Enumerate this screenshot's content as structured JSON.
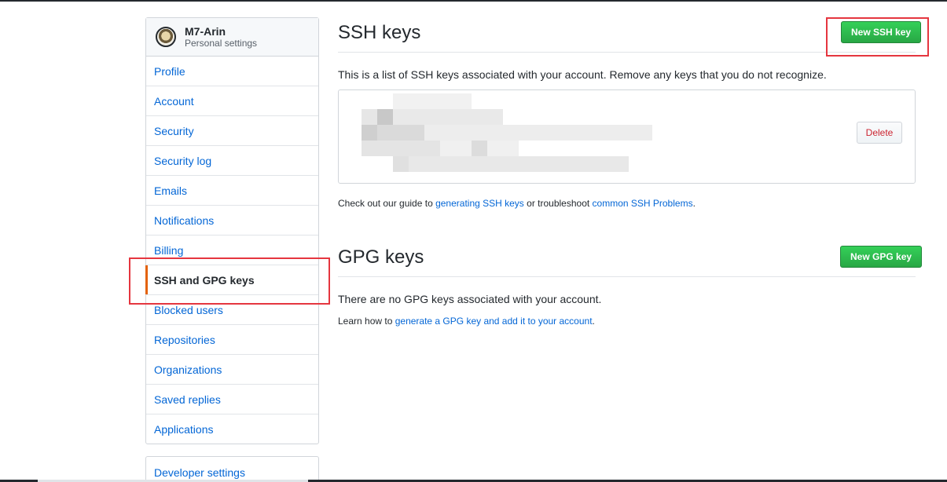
{
  "user": {
    "name": "M7-Arin",
    "subtitle": "Personal settings"
  },
  "sidebar": {
    "items": [
      {
        "label": "Profile"
      },
      {
        "label": "Account"
      },
      {
        "label": "Security"
      },
      {
        "label": "Security log"
      },
      {
        "label": "Emails"
      },
      {
        "label": "Notifications"
      },
      {
        "label": "Billing"
      },
      {
        "label": "SSH and GPG keys",
        "selected": true
      },
      {
        "label": "Blocked users"
      },
      {
        "label": "Repositories"
      },
      {
        "label": "Organizations"
      },
      {
        "label": "Saved replies"
      },
      {
        "label": "Applications"
      }
    ],
    "developer_label": "Developer settings"
  },
  "ssh": {
    "title": "SSH keys",
    "new_button": "New SSH key",
    "description": "This is a list of SSH keys associated with your account. Remove any keys that you do not recognize.",
    "delete_button": "Delete",
    "guide_prefix": "Check out our guide to ",
    "guide_link": "generating SSH keys",
    "guide_middle": " or troubleshoot ",
    "guide_link2": "common SSH Problems",
    "guide_suffix": "."
  },
  "gpg": {
    "title": "GPG keys",
    "new_button": "New GPG key",
    "empty_text": "There are no GPG keys associated with your account.",
    "learn_prefix": "Learn how to ",
    "learn_link": "generate a GPG key and add it to your account",
    "learn_suffix": "."
  },
  "colors": {
    "link": "#0366d6",
    "green_button": "#28a745",
    "selected_accent": "#e36209",
    "annotation": "#e5363f",
    "danger": "#cb2431"
  }
}
